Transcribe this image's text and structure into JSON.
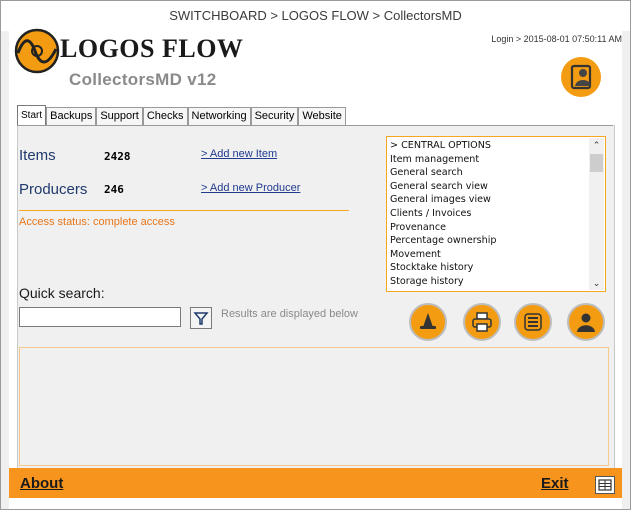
{
  "window": {
    "title": "SWITCHBOARD > LOGOS FLOW > CollectorsMD"
  },
  "header": {
    "app_name": "LOGOS FLOW",
    "app_sub": "CollectorsMD v12",
    "login_info": "Login > 2015-08-01 07:50:11 AM",
    "logo_icon": "logos-flow-logo-icon",
    "user_icon": "user-badge-icon"
  },
  "tabs": [
    {
      "label": "Start",
      "active": true
    },
    {
      "label": "Backups"
    },
    {
      "label": "Support"
    },
    {
      "label": "Checks"
    },
    {
      "label": "Networking"
    },
    {
      "label": "Security"
    },
    {
      "label": "Website"
    }
  ],
  "stats": {
    "items_label": "Items",
    "items_value": "2428",
    "items_link": "> Add new Item",
    "producers_label": "Producers",
    "producers_value": "246",
    "producers_link": "> Add new Producer",
    "access": "Access status: complete access"
  },
  "central_options": {
    "items": [
      "> CENTRAL OPTIONS",
      "Item management",
      "General search",
      "General search view",
      "General images view",
      "Clients / Invoices",
      "Provenance",
      "Percentage ownership",
      "Movement",
      "Stocktake history",
      "Storage history"
    ]
  },
  "search": {
    "label": "Quick search:",
    "value": "",
    "placeholder": "",
    "note": "Results are displayed below"
  },
  "action_buttons": [
    {
      "name": "witch-hat-icon"
    },
    {
      "name": "printer-icon"
    },
    {
      "name": "list-icon"
    },
    {
      "name": "person-icon"
    }
  ],
  "footer": {
    "about": "About",
    "exit": "Exit"
  },
  "colors": {
    "accent": "#f7941d",
    "link": "#1f3a8f",
    "access_text": "#e8761a"
  }
}
